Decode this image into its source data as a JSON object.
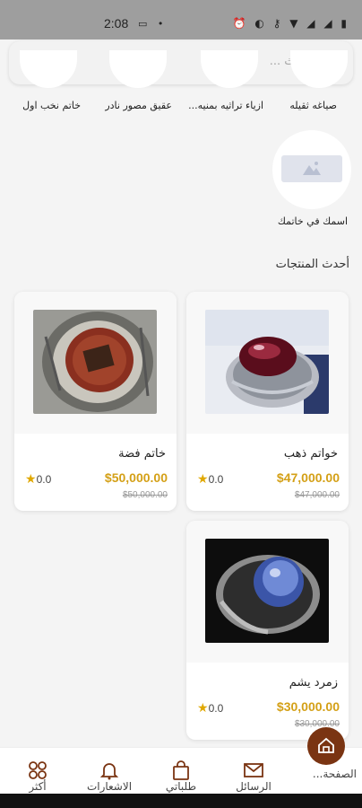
{
  "status_bar": {
    "time": "2:08",
    "left_icons": "▭  •",
    "right_icons": "⏰ ◐ ⚷ ▼ ◢ ◢ ▮"
  },
  "search": {
    "placeholder": "بحث ..."
  },
  "categories": [
    {
      "label": "صياغه ثقيله"
    },
    {
      "label": "ازياء تراثيه بمنيه..."
    },
    {
      "label": "عقيق مصور نادر"
    },
    {
      "label": "خاتم نخب اول"
    }
  ],
  "featured_category": {
    "label": "اسمك في خاتمك"
  },
  "section_title": "أحدث المنتجات",
  "products": [
    {
      "name": "خواتم ذهب",
      "price": "$47,000.00",
      "old_price": "$47,000.00",
      "rating": "0.0"
    },
    {
      "name": "خاتم فضة",
      "price": "$50,000.00",
      "old_price": "$50,000.00",
      "rating": "0.0"
    },
    {
      "name": "زمرد يشم",
      "price": "$30,000.00",
      "old_price": "$30,000.00",
      "rating": "0.0"
    }
  ],
  "bottom_nav": {
    "home": "الصفحة...",
    "messages": "الرسائل",
    "orders": "طلباتي",
    "notifications": "الاشعارات",
    "more": "أكثر"
  },
  "colors": {
    "accent_gold": "#d4a017",
    "brand_brown": "#7a3412",
    "star": "#e0a800"
  }
}
